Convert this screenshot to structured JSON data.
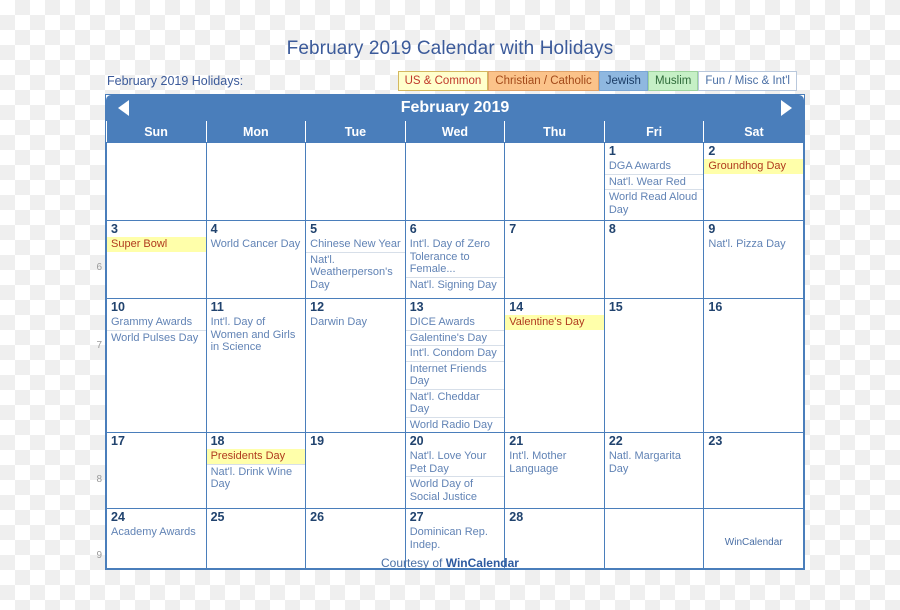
{
  "page": {
    "title": "February 2019 Calendar with Holidays",
    "footer_prefix": "Courtesy of ",
    "footer_brand": "WinCalendar",
    "watermark": "WinCalendar"
  },
  "legend": {
    "label": "February 2019 Holidays:",
    "buttons": [
      {
        "label": "US & Common",
        "bg": "#ffffcc",
        "fg": "#c0392b"
      },
      {
        "label": "Christian / Catholic",
        "bg": "#fbc38a",
        "fg": "#a34a1a"
      },
      {
        "label": "Jewish",
        "bg": "#8fb8e0",
        "fg": "#1b3c66"
      },
      {
        "label": "Muslim",
        "bg": "#c6f0c6",
        "fg": "#2f6b3a"
      },
      {
        "label": "Fun / Misc & Int'l",
        "bg": "#ffffff",
        "fg": "#4a6fa5"
      }
    ]
  },
  "calendar": {
    "title": "February 2019",
    "prev_arrow": "prev-month",
    "next_arrow": "next-month",
    "accent_color": "#4a7ebb",
    "weekday_headers": [
      "Sun",
      "Mon",
      "Tue",
      "Wed",
      "Thu",
      "Fri",
      "Sat"
    ],
    "week_numbers": [
      "6",
      "7",
      "8",
      "9"
    ],
    "weeks": [
      {
        "days": [
          {
            "num": "",
            "offmonth": true,
            "events": []
          },
          {
            "num": "",
            "offmonth": true,
            "events": []
          },
          {
            "num": "",
            "offmonth": true,
            "events": []
          },
          {
            "num": "",
            "offmonth": true,
            "events": []
          },
          {
            "num": "",
            "offmonth": true,
            "events": []
          },
          {
            "num": "1",
            "events": [
              {
                "text": "DGA Awards",
                "highlight": false
              },
              {
                "text": "Nat'l. Wear Red",
                "highlight": false
              },
              {
                "text": "World Read Aloud Day",
                "highlight": false
              }
            ]
          },
          {
            "num": "2",
            "weekend": true,
            "events": [
              {
                "text": "Groundhog Day",
                "highlight": true
              }
            ]
          }
        ]
      },
      {
        "days": [
          {
            "num": "3",
            "weekend": true,
            "events": [
              {
                "text": "Super Bowl",
                "highlight": true
              }
            ]
          },
          {
            "num": "4",
            "events": [
              {
                "text": "World Cancer Day",
                "highlight": false
              }
            ]
          },
          {
            "num": "5",
            "events": [
              {
                "text": "Chinese New Year",
                "highlight": false
              },
              {
                "text": "Nat'l. Weatherperson's Day",
                "highlight": false
              }
            ]
          },
          {
            "num": "6",
            "events": [
              {
                "text": "Int'l. Day of Zero Tolerance to Female...",
                "highlight": false
              },
              {
                "text": "Nat'l. Signing Day",
                "highlight": false
              }
            ]
          },
          {
            "num": "7",
            "events": []
          },
          {
            "num": "8",
            "events": []
          },
          {
            "num": "9",
            "weekend": true,
            "events": [
              {
                "text": "Nat'l. Pizza Day",
                "highlight": false
              }
            ]
          }
        ]
      },
      {
        "days": [
          {
            "num": "10",
            "weekend": true,
            "events": [
              {
                "text": "Grammy Awards",
                "highlight": false
              },
              {
                "text": "World Pulses Day",
                "highlight": false
              }
            ]
          },
          {
            "num": "11",
            "events": [
              {
                "text": "Int'l. Day of Women and Girls in Science",
                "highlight": false
              }
            ]
          },
          {
            "num": "12",
            "events": [
              {
                "text": "Darwin Day",
                "highlight": false
              }
            ]
          },
          {
            "num": "13",
            "events": [
              {
                "text": "DICE Awards",
                "highlight": false
              },
              {
                "text": "Galentine's Day",
                "highlight": false
              },
              {
                "text": "Int'l. Condom Day",
                "highlight": false
              },
              {
                "text": "Internet Friends Day",
                "highlight": false
              },
              {
                "text": "Nat'l. Cheddar Day",
                "highlight": false
              },
              {
                "text": "World Radio Day",
                "highlight": false
              }
            ]
          },
          {
            "num": "14",
            "events": [
              {
                "text": "Valentine's Day",
                "highlight": true
              }
            ]
          },
          {
            "num": "15",
            "events": []
          },
          {
            "num": "16",
            "weekend": true,
            "events": []
          }
        ]
      },
      {
        "days": [
          {
            "num": "17",
            "weekend": true,
            "events": []
          },
          {
            "num": "18",
            "events": [
              {
                "text": "Presidents Day",
                "highlight": true
              },
              {
                "text": "Nat'l. Drink Wine Day",
                "highlight": false
              }
            ]
          },
          {
            "num": "19",
            "events": []
          },
          {
            "num": "20",
            "events": [
              {
                "text": "Nat'l. Love Your Pet Day",
                "highlight": false
              },
              {
                "text": "World Day of Social Justice",
                "highlight": false
              }
            ]
          },
          {
            "num": "21",
            "events": [
              {
                "text": "Int'l. Mother Language",
                "highlight": false
              }
            ]
          },
          {
            "num": "22",
            "events": [
              {
                "text": "Natl. Margarita Day",
                "highlight": false
              }
            ]
          },
          {
            "num": "23",
            "weekend": true,
            "events": []
          }
        ]
      },
      {
        "days": [
          {
            "num": "24",
            "weekend": true,
            "events": [
              {
                "text": "Academy Awards",
                "highlight": false
              }
            ]
          },
          {
            "num": "25",
            "events": []
          },
          {
            "num": "26",
            "events": []
          },
          {
            "num": "27",
            "events": [
              {
                "text": "Dominican Rep. Indep.",
                "highlight": false
              }
            ]
          },
          {
            "num": "28",
            "events": []
          },
          {
            "num": "",
            "offmonth": true,
            "events": []
          },
          {
            "num": "",
            "offmonth": true,
            "watermark": true,
            "events": []
          }
        ]
      }
    ]
  }
}
